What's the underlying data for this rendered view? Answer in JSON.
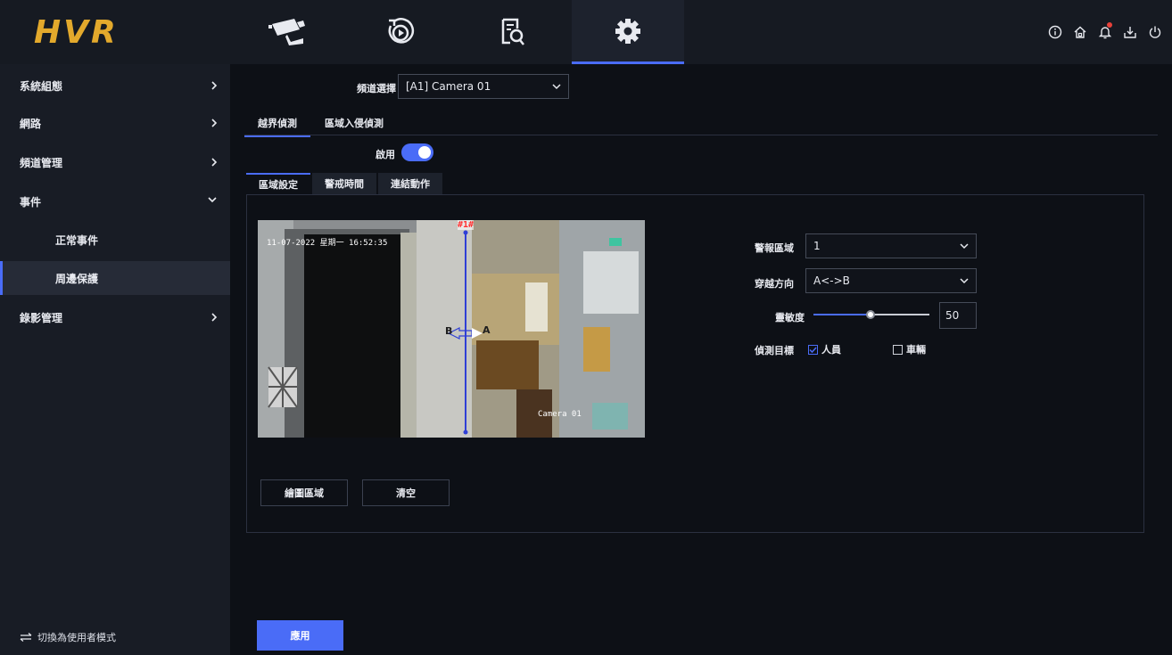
{
  "app": {
    "logo": "HVR"
  },
  "topnav": {
    "tabs": [
      {
        "icon": "camera-icon"
      },
      {
        "icon": "playback-icon"
      },
      {
        "icon": "search-file-icon"
      },
      {
        "icon": "gear-icon"
      }
    ],
    "right_icons": [
      "info-icon",
      "home-icon",
      "bell-icon",
      "download-icon",
      "power-icon"
    ]
  },
  "sidebar": {
    "items": [
      {
        "label": "系統組態"
      },
      {
        "label": "網路"
      },
      {
        "label": "頻道管理"
      },
      {
        "label": "事件"
      },
      {
        "label": "正常事件"
      },
      {
        "label": "周邊保護"
      },
      {
        "label": "錄影管理"
      }
    ],
    "footer": "切換為使用者模式"
  },
  "main": {
    "channel_label": "頻道選擇",
    "channel_value": "[A1] Camera 01",
    "tabs": [
      "越界偵測",
      "區域入侵偵測"
    ],
    "enable_label": "啟用",
    "subtabs": [
      "區域設定",
      "警戒時間",
      "連結動作"
    ],
    "video": {
      "osd_time": "11-07-2022 星期一 16:52:35",
      "line_label": "#1#",
      "side_b": "B",
      "side_a": "A",
      "camera_name": "Camera 01"
    },
    "form": {
      "zone_label": "警報區域",
      "zone_value": "1",
      "direction_label": "穿越方向",
      "direction_value": "A<->B",
      "sensitivity_label": "靈敏度",
      "sensitivity_value": "50",
      "target_label": "偵測目標",
      "target_person": "人員",
      "target_person_checked": true,
      "target_vehicle": "車輛",
      "target_vehicle_checked": false
    },
    "draw_button": "繪圖區域",
    "clear_button": "清空",
    "apply_button": "應用"
  }
}
